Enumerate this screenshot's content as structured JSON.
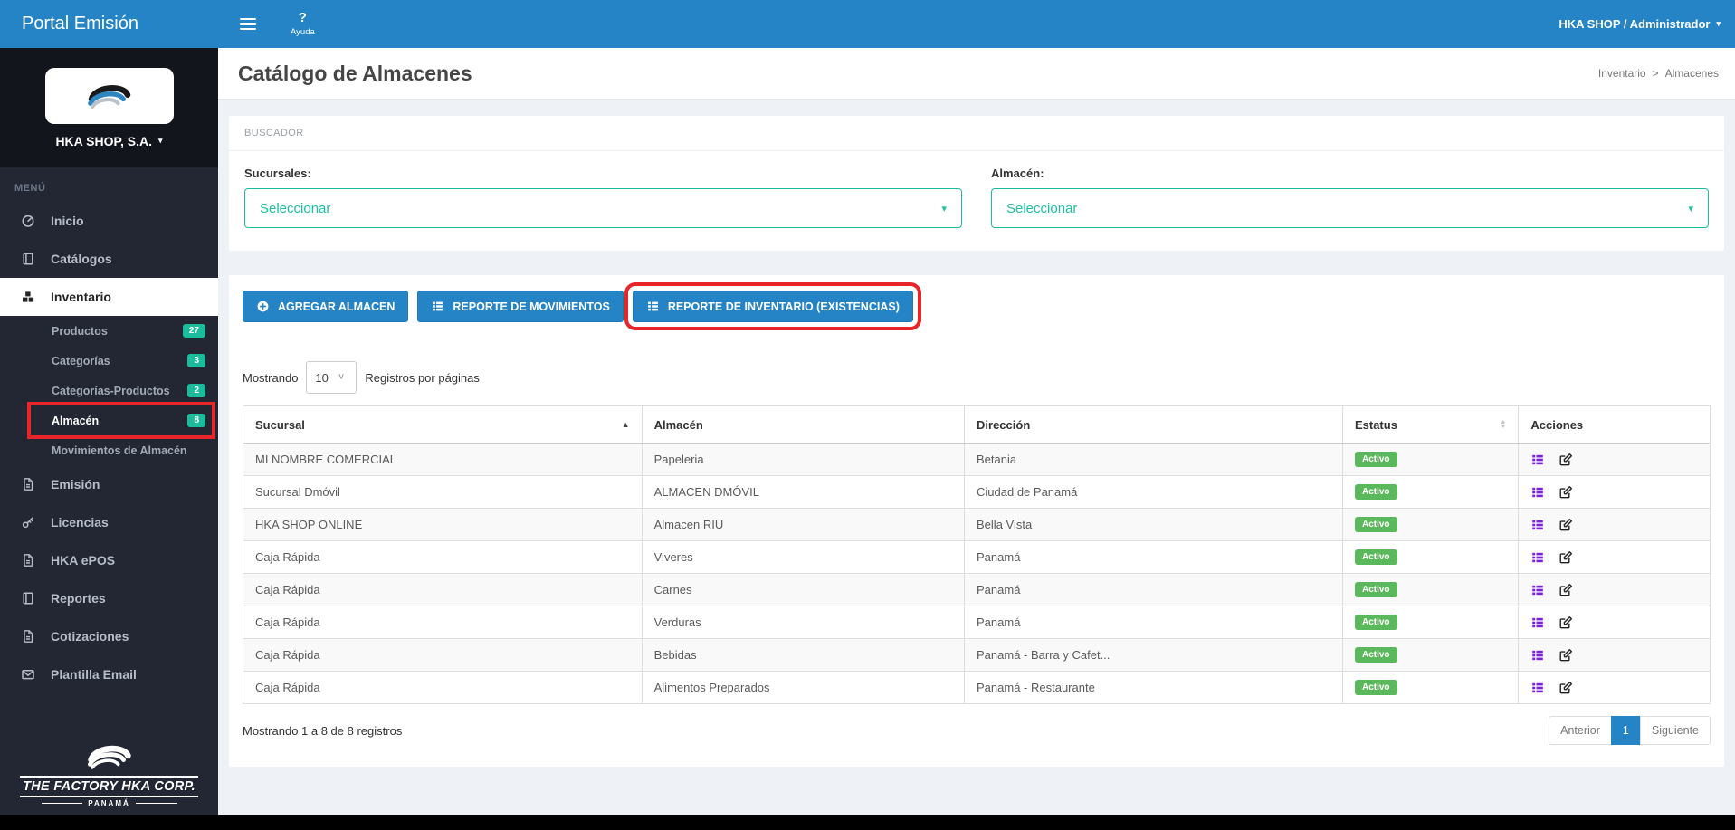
{
  "header": {
    "brand": "Portal Emisión",
    "help_icon": "?",
    "help_label": "Ayuda",
    "user": "HKA SHOP / Administrador"
  },
  "sidebar": {
    "company": "HKA SHOP, S.A.",
    "menu_label": "MENÚ",
    "items": [
      {
        "name": "sidebar-item-inicio",
        "label": "Inicio",
        "icon": "gauge-icon"
      },
      {
        "name": "sidebar-item-catalogos",
        "label": "Catálogos",
        "icon": "book-icon"
      },
      {
        "name": "sidebar-item-inventario",
        "label": "Inventario",
        "icon": "cubes-icon",
        "active": true
      },
      {
        "name": "sidebar-item-productos",
        "label": "Productos",
        "sub": true,
        "badge": "27"
      },
      {
        "name": "sidebar-item-categorias",
        "label": "Categorías",
        "sub": true,
        "badge": "3"
      },
      {
        "name": "sidebar-item-categorias-productos",
        "label": "Categorías-Productos",
        "sub": true,
        "badge": "2"
      },
      {
        "name": "sidebar-item-almacen",
        "label": "Almacén",
        "sub": true,
        "badge": "8",
        "current": true,
        "highlighted": true
      },
      {
        "name": "sidebar-item-movimientos-almacen",
        "label": "Movimientos de Almacén",
        "sub": true
      },
      {
        "name": "sidebar-item-emision",
        "label": "Emisión",
        "icon": "file-icon"
      },
      {
        "name": "sidebar-item-licencias",
        "label": "Licencias",
        "icon": "key-icon"
      },
      {
        "name": "sidebar-item-hka-epos",
        "label": "HKA ePOS",
        "icon": "file-icon"
      },
      {
        "name": "sidebar-item-reportes",
        "label": "Reportes",
        "icon": "book-icon"
      },
      {
        "name": "sidebar-item-cotizaciones",
        "label": "Cotizaciones",
        "icon": "file-icon"
      },
      {
        "name": "sidebar-item-plantilla-email",
        "label": "Plantilla Email",
        "icon": "envelope-icon"
      }
    ],
    "footer_logo": {
      "name": "THE FACTORY HKA CORP.",
      "country": "PANAMÁ"
    }
  },
  "page": {
    "title": "Catálogo de Almacenes",
    "breadcrumb": [
      "Inventario",
      "Almacenes"
    ],
    "breadcrumb_sep": ">"
  },
  "search_panel": {
    "title": "BUSCADOR",
    "fields": [
      {
        "label": "Sucursales:",
        "value": "Seleccionar"
      },
      {
        "label": "Almacén:",
        "value": "Seleccionar"
      }
    ]
  },
  "toolbar": {
    "buttons": [
      {
        "label": "AGREGAR ALMACEN",
        "icon": "plus-circle-icon"
      },
      {
        "label": "REPORTE DE MOVIMIENTOS",
        "icon": "report-icon"
      },
      {
        "label": "REPORTE DE INVENTARIO (EXISTENCIAS)",
        "icon": "report-icon",
        "highlighted": true
      }
    ]
  },
  "table": {
    "length_prefix": "Mostrando",
    "page_size": "10",
    "length_suffix": "Registros por páginas",
    "columns": [
      "Sucursal",
      "Almacén",
      "Dirección",
      "Estatus",
      "Acciones"
    ],
    "rows": [
      {
        "sucursal": "MI NOMBRE COMERCIAL",
        "almacen": "Papeleria",
        "direccion": "Betania",
        "estatus": "Activo"
      },
      {
        "sucursal": "Sucursal Dmóvil",
        "almacen": "ALMACEN DMÓVIL",
        "direccion": "Ciudad de Panamá",
        "estatus": "Activo"
      },
      {
        "sucursal": "HKA SHOP ONLINE",
        "almacen": "Almacen RIU",
        "direccion": "Bella Vista",
        "estatus": "Activo"
      },
      {
        "sucursal": "Caja Rápida",
        "almacen": "Viveres",
        "direccion": "Panamá",
        "estatus": "Activo"
      },
      {
        "sucursal": "Caja Rápida",
        "almacen": "Carnes",
        "direccion": "Panamá",
        "estatus": "Activo"
      },
      {
        "sucursal": "Caja Rápida",
        "almacen": "Verduras",
        "direccion": "Panamá",
        "estatus": "Activo"
      },
      {
        "sucursal": "Caja Rápida",
        "almacen": "Bebidas",
        "direccion": "Panamá - Barra y Cafet...",
        "estatus": "Activo"
      },
      {
        "sucursal": "Caja Rápida",
        "almacen": "Alimentos Preparados",
        "direccion": "Panamá - Restaurante",
        "estatus": "Activo"
      }
    ],
    "footer_info": "Mostrando 1 a 8 de 8 registros",
    "pagination": {
      "prev": "Anterior",
      "page": "1",
      "next": "Siguiente"
    }
  },
  "icons": {
    "caret_char": "▾",
    "chevron_char": "˅",
    "sort_asc_char": "▲",
    "sort_desc_char": "▼"
  },
  "colors": {
    "accent_blue": "#2484c6",
    "teal": "#1abc9c",
    "green_status": "#5cb85c",
    "purple_action": "#7b1fe0",
    "annotation_red": "#e8262a",
    "sidebar_dark": "#222733",
    "sidebar_darker": "#12151c"
  }
}
